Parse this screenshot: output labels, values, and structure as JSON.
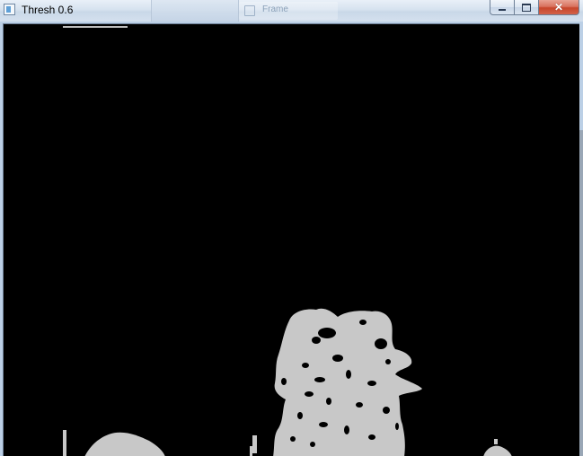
{
  "window": {
    "title": "Thresh 0.6",
    "background_ghost_label": "Frame"
  },
  "caption_buttons": {
    "minimize_glyph": "—",
    "maximize_glyph": "□",
    "close_glyph": "✕"
  },
  "image": {
    "description_role": "binary threshold mask output",
    "background_color": "#000000",
    "foreground_color": "#c8c8c8"
  },
  "icons": {
    "app_icon": "window-app-icon",
    "minimize": "minimize-icon",
    "maximize": "maximize-icon",
    "close": "close-icon"
  }
}
